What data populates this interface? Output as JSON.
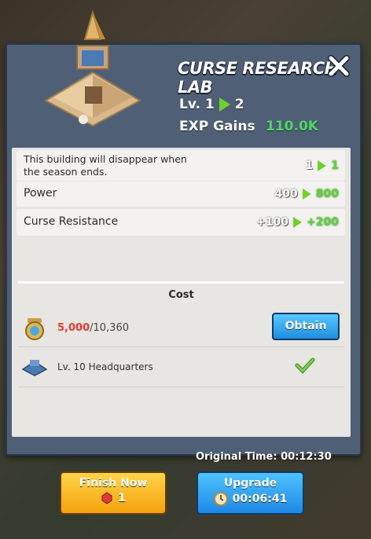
{
  "header": {
    "title": "CURSE RESEARCH LAB",
    "level_label": "Lv. 1",
    "level_next": "2",
    "exp_label": "EXP Gains",
    "exp_value": "110.0K"
  },
  "stats": [
    {
      "label": "This building will disappear when the season ends.",
      "old": "1",
      "new": "1"
    },
    {
      "label": "Power",
      "old": "400",
      "new": "800"
    },
    {
      "label": "Curse Resistance",
      "old": "+100",
      "new": "+200"
    }
  ],
  "cost": {
    "header": "Cost",
    "resource_have": "5,000",
    "resource_need": "/10,360",
    "obtain_label": "Obtain",
    "requirement": "Lv. 10 Headquarters"
  },
  "footer": {
    "original_time": "Original Time: 00:12:30",
    "finish_label": "Finish Now",
    "finish_cost": "1",
    "upgrade_label": "Upgrade",
    "upgrade_time": "00:06:41"
  },
  "colors": {
    "accent_green": "#5fd43a",
    "obtain_blue": "#1d8ee0",
    "finish_yellow": "#f4a20c",
    "cost_red": "#e33b30"
  }
}
